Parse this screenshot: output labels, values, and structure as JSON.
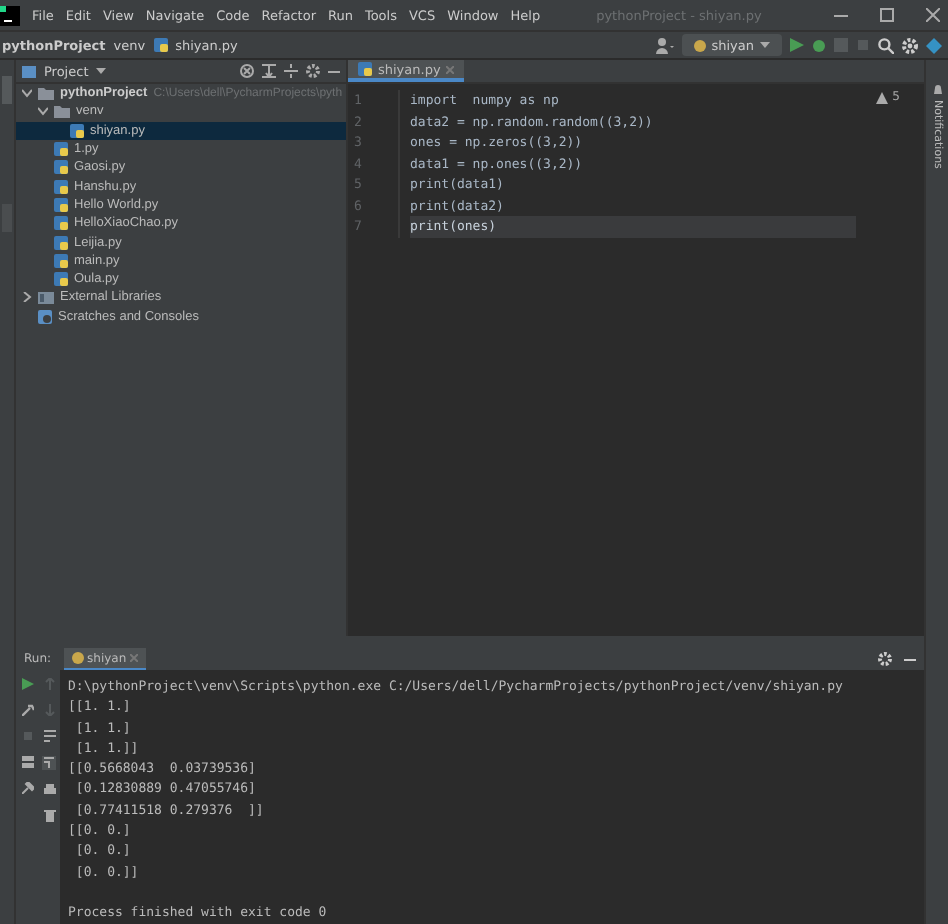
{
  "menu_bar": {
    "items": [
      "File",
      "Edit",
      "View",
      "Navigate",
      "Code",
      "Refactor",
      "Run",
      "Tools",
      "VCS",
      "Window",
      "Help"
    ],
    "title": "pythonProject - shiyan.py"
  },
  "nav_bar": {
    "breadcrumbs": [
      "pythonProject",
      "venv",
      "shiyan.py"
    ],
    "run_config": "shiyan"
  },
  "project_panel": {
    "title": "Project",
    "tree": [
      {
        "label": "pythonProject",
        "path": "C:\\Users\\dell\\PycharmProjects\\pyth",
        "kind": "folder",
        "expanded": true,
        "selected": false,
        "children": [
          {
            "label": "venv",
            "kind": "folder",
            "expanded": true,
            "selected": false,
            "children": [
              {
                "label": "shiyan.py",
                "kind": "python",
                "selected": true
              }
            ]
          },
          {
            "label": "1.py",
            "kind": "python",
            "selected": false
          },
          {
            "label": "Gaosi.py",
            "kind": "python",
            "selected": false
          },
          {
            "label": "Hanshu.py",
            "kind": "python",
            "selected": false
          },
          {
            "label": "Hello World.py",
            "kind": "python",
            "selected": false
          },
          {
            "label": "HelloXiaoChao.py",
            "kind": "python",
            "selected": false
          },
          {
            "label": "Leijia.py",
            "kind": "python",
            "selected": false
          },
          {
            "label": "main.py",
            "kind": "python",
            "selected": false
          },
          {
            "label": "Oula.py",
            "kind": "python",
            "selected": false
          }
        ]
      },
      {
        "label": "External Libraries",
        "kind": "library",
        "expanded": false,
        "selected": false
      },
      {
        "label": "Scratches and Consoles",
        "kind": "scratch",
        "selected": false
      }
    ]
  },
  "editor": {
    "tabs": [
      {
        "label": "shiyan.py",
        "selected": true
      }
    ],
    "warnings": "5",
    "lines": [
      {
        "text": "import  numpy as np",
        "current": false
      },
      {
        "text": "data2 = np.random.random((3,2))",
        "current": false
      },
      {
        "text": "ones = np.zeros((3,2))",
        "current": false
      },
      {
        "text": "data1 = np.ones((3,2))",
        "current": false
      },
      {
        "text": "print(data1)",
        "current": false
      },
      {
        "text": "print(data2)",
        "current": false
      },
      {
        "text": "print(ones)",
        "current": true
      }
    ],
    "line_numbers": [
      "1",
      "2",
      "3",
      "4",
      "5",
      "6",
      "7"
    ]
  },
  "right_stripe": {
    "label": "Notifications"
  },
  "run_panel": {
    "label": "Run:",
    "tabs": [
      {
        "label": "shiyan",
        "selected": true
      }
    ],
    "output": [
      "D:\\pythonProject\\venv\\Scripts\\python.exe C:/Users/dell/PycharmProjects/pythonProject/venv/shiyan.py",
      "[[1. 1.]",
      " [1. 1.]",
      " [1. 1.]]",
      "[[0.5668043  0.03739536]",
      " [0.12830889 0.47055746]",
      " [0.77411518 0.279376  ]]",
      "[[0. 0.]",
      " [0. 0.]",
      " [0. 0.]]"
    ],
    "exit_message": "Process finished with exit code 0"
  }
}
